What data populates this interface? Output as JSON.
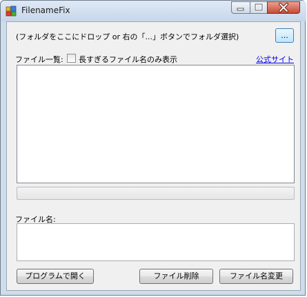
{
  "window": {
    "title": "FilenameFix",
    "min_symbol": "—",
    "max_symbol": "□",
    "close_symbol": "✕"
  },
  "folder": {
    "instruction": "(フォルダをここにドロップ or 右の「...」ボタンでフォルダ選択)",
    "browse_label": "..."
  },
  "file_list": {
    "label": "ファイル一覧:",
    "long_only_label": "長すぎるファイル名のみ表示",
    "long_only_checked": false,
    "official_site_label": "公式サイト",
    "items": []
  },
  "progress": {
    "value": 0
  },
  "filename": {
    "label": "ファイル名:",
    "value": ""
  },
  "buttons": {
    "open_with_program": "プログラムで開く",
    "delete_file": "ファイル削除",
    "rename_file": "ファイル名変更"
  }
}
